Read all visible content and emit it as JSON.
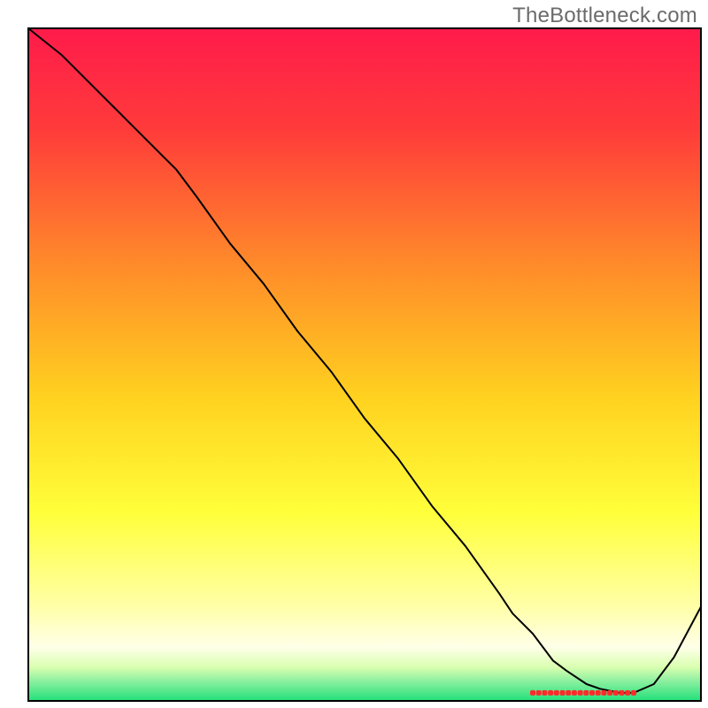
{
  "watermark": "TheBottleneck.com",
  "chart_data": {
    "type": "line",
    "title": "",
    "xlabel": "",
    "ylabel": "",
    "xlim": [
      0,
      100
    ],
    "ylim": [
      0,
      100
    ],
    "background_gradient": {
      "stops": [
        {
          "offset": 0,
          "color": "#ff1b4b"
        },
        {
          "offset": 15,
          "color": "#ff3b3a"
        },
        {
          "offset": 35,
          "color": "#ff8a2a"
        },
        {
          "offset": 55,
          "color": "#ffd21f"
        },
        {
          "offset": 72,
          "color": "#ffff3a"
        },
        {
          "offset": 86,
          "color": "#ffffa8"
        },
        {
          "offset": 92,
          "color": "#ffffe8"
        },
        {
          "offset": 95,
          "color": "#d9ffb0"
        },
        {
          "offset": 97,
          "color": "#8ef0a0"
        },
        {
          "offset": 100,
          "color": "#22e07a"
        }
      ]
    },
    "series": [
      {
        "name": "bottleneck-curve",
        "color": "#000000",
        "width": 2,
        "x": [
          0,
          5,
          10,
          15,
          20,
          22,
          25,
          30,
          35,
          40,
          45,
          50,
          55,
          60,
          65,
          70,
          72,
          75,
          78,
          80,
          83,
          85,
          88,
          90,
          93,
          96,
          100
        ],
        "y": [
          100,
          96,
          91,
          86,
          81,
          79,
          75,
          68,
          62,
          55,
          49,
          42,
          36,
          29,
          23,
          16,
          13,
          10,
          6,
          4.5,
          2.5,
          1.8,
          1.2,
          1.2,
          2.5,
          6.5,
          14
        ]
      }
    ],
    "flat_marker": {
      "color": "#ff2a2a",
      "y": 1.2,
      "x_start": 75,
      "x_end": 90,
      "dot_count": 18
    },
    "inner_frame": {
      "left_pct": 4.0,
      "top_pct": 4.0,
      "right_pct": 99.0,
      "bottom_pct": 99.0,
      "stroke": "#000000",
      "stroke_width": 2
    }
  }
}
